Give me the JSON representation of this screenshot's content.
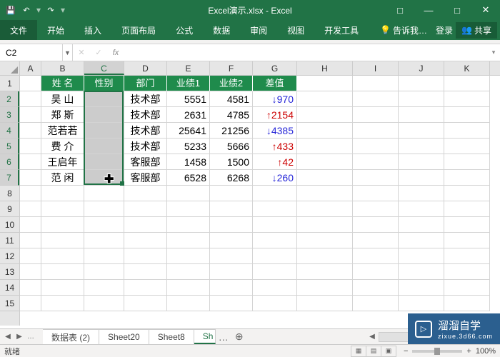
{
  "app": {
    "title": "Excel演示.xlsx - Excel"
  },
  "window": {
    "min": "—",
    "max": "□",
    "close": "✕",
    "ribbonMin": "□"
  },
  "qat": {
    "save": "💾",
    "undo": "↶",
    "redo": "↷",
    "dd": "▾"
  },
  "tabs": {
    "file": "文件",
    "home": "开始",
    "insert": "插入",
    "layout": "页面布局",
    "formulas": "公式",
    "data": "数据",
    "review": "审阅",
    "view": "视图",
    "dev": "开发工具"
  },
  "ribbon_right": {
    "tellme": "告诉我…",
    "login": "登录",
    "share": "共享"
  },
  "namebox": "C2",
  "fx": {
    "cancel": "✕",
    "enter": "✓",
    "fx": "fx"
  },
  "cols": [
    "A",
    "B",
    "C",
    "D",
    "E",
    "F",
    "G",
    "H",
    "I",
    "J",
    "K"
  ],
  "rows": [
    "1",
    "2",
    "3",
    "4",
    "5",
    "6",
    "7",
    "8",
    "9",
    "10",
    "11",
    "12",
    "13",
    "14",
    "15"
  ],
  "headers": {
    "name": "姓    名",
    "gender": "性别",
    "dept": "部门",
    "s1": "业绩1",
    "s2": "业绩2",
    "diff": "差值"
  },
  "data_rows": [
    {
      "name": "吴    山",
      "dept": "技术部",
      "s1": "5551",
      "s2": "4581",
      "diff": "↓970",
      "cls": "blue"
    },
    {
      "name": "郑    斯",
      "dept": "技术部",
      "s1": "2631",
      "s2": "4785",
      "diff": "↑2154",
      "cls": "red"
    },
    {
      "name": "范若若",
      "dept": "技术部",
      "s1": "25641",
      "s2": "21256",
      "diff": "↓4385",
      "cls": "blue"
    },
    {
      "name": "费    介",
      "dept": "技术部",
      "s1": "5233",
      "s2": "5666",
      "diff": "↑433",
      "cls": "red"
    },
    {
      "name": "王启年",
      "dept": "客服部",
      "s1": "1458",
      "s2": "1500",
      "diff": "↑42",
      "cls": "red"
    },
    {
      "name": "范    闲",
      "dept": "客服部",
      "s1": "6528",
      "s2": "6268",
      "diff": "↓260",
      "cls": "blue"
    }
  ],
  "sheets": {
    "nav_l": "◀",
    "nav_r": "▶",
    "more": "…",
    "list": [
      "数据表 (2)",
      "Sheet20",
      "Sheet8",
      "Sh"
    ],
    "active": 3,
    "add": "⊕"
  },
  "status": {
    "ready": "就绪",
    "zoom": "100%",
    "minus": "−",
    "plus": "+"
  },
  "watermark": {
    "brand": "溜溜自学",
    "url": "zixue.3d66.com",
    "play": "▷"
  }
}
